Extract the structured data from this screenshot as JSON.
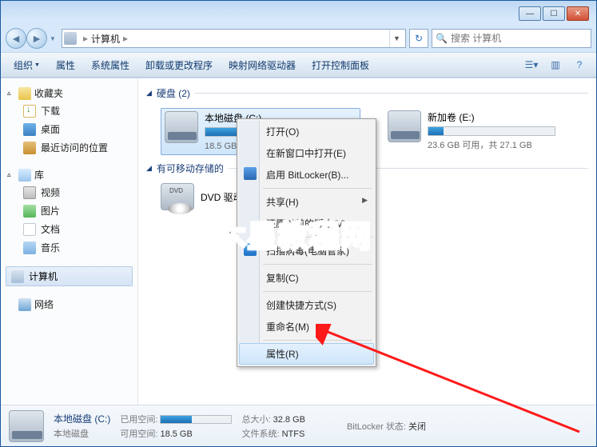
{
  "title_controls": {
    "min": "—",
    "max": "☐",
    "close": "✕"
  },
  "nav": {
    "back": "◄",
    "fwd": "►"
  },
  "address": {
    "icon_name": "computer-icon",
    "seg1": "计算机",
    "arrow": "▸"
  },
  "search": {
    "placeholder": "搜索 计算机"
  },
  "toolbar": {
    "organize": "组织",
    "properties": "属性",
    "sys_props": "系统属性",
    "uninstall": "卸载或更改程序",
    "map_drive": "映射网络驱动器",
    "control_panel": "打开控制面板"
  },
  "sidebar": {
    "favorites": "收藏夹",
    "downloads": "下载",
    "desktop": "桌面",
    "recent": "最近访问的位置",
    "libraries": "库",
    "videos": "视频",
    "pictures": "图片",
    "documents": "文档",
    "music": "音乐",
    "computer": "计算机",
    "network": "网络"
  },
  "main": {
    "hdd_header": "硬盘 (2)",
    "removable_header": "有可移动存储的",
    "drive_c": {
      "name": "本地磁盘 (C:)",
      "stats": "18.5 GB 可",
      "fill_pct": 44
    },
    "drive_e": {
      "name": "新加卷 (E:)",
      "stats": "23.6 GB 可用，共 27.1 GB",
      "fill_pct": 12
    },
    "dvd": "DVD 驱动"
  },
  "ctx": {
    "open": "打开(O)",
    "open_new": "在新窗口中打开(E)",
    "bitlocker": "启用 BitLocker(B)...",
    "share": "共享(H)",
    "prev_versions": "还原以前的版本(V)",
    "scan": "扫描病毒(电脑管家)",
    "copy": "复制(C)",
    "shortcut": "创建快捷方式(S)",
    "rename": "重命名(M)",
    "properties": "属性(R)"
  },
  "details": {
    "title": "本地磁盘 (C:)",
    "subtitle": "本地磁盘",
    "used_label": "已用空间:",
    "free_label": "可用空间:",
    "free_val": "18.5 GB",
    "total_label": "总大小:",
    "total_val": "32.8 GB",
    "fs_label": "文件系统:",
    "fs_val": "NTFS",
    "bl_label": "BitLocker 状态:",
    "bl_val": "关闭"
  },
  "watermark": "木星教程网"
}
